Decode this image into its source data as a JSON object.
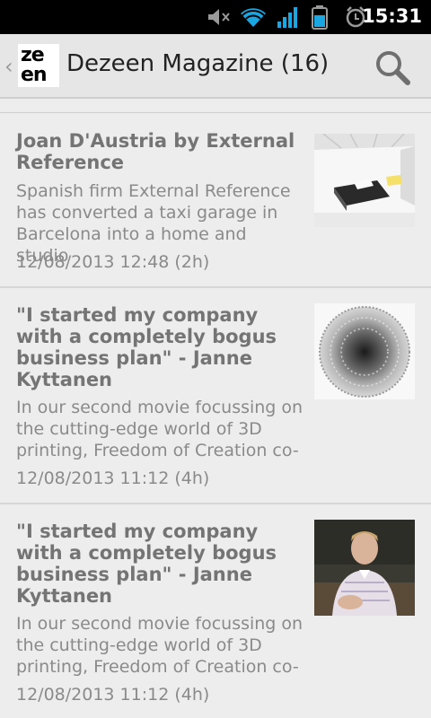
{
  "status_bar": {
    "time": "15:31",
    "icons": [
      "mute-icon",
      "wifi-icon",
      "signal-icon",
      "battery-icon",
      "alarm-icon"
    ]
  },
  "action_bar": {
    "logo_top": "ze",
    "logo_bottom": "en",
    "title": "Dezeen Magazine (16)",
    "icons": [
      "up-caret-icon",
      "search-icon"
    ]
  },
  "articles": [
    {
      "title": "Joan D'Austria by External Reference",
      "summary": "Spanish firm External Reference has converted a taxi garage in Barcelona into a home and studio",
      "time": "12/08/2013 12:48 (2h)",
      "thumbnail": "white-interior-photo"
    },
    {
      "title": "\"I started my company with a completely bogus business plan\" - Janne Kyttanen",
      "summary": "In our second movie focussing on the cutting-edge world of 3D printing, Freedom of Creation co-",
      "time": "12/08/2013 11:12 (4h)",
      "thumbnail": "3d-printed-sphere-photo"
    },
    {
      "title": "\"I started my company with a completely bogus business plan\" - Janne Kyttanen",
      "summary": "In our second movie focussing on the cutting-edge world of 3D printing, Freedom of Creation co-",
      "time": "12/08/2013 11:12 (4h)",
      "thumbnail": "portrait-photo"
    }
  ]
}
